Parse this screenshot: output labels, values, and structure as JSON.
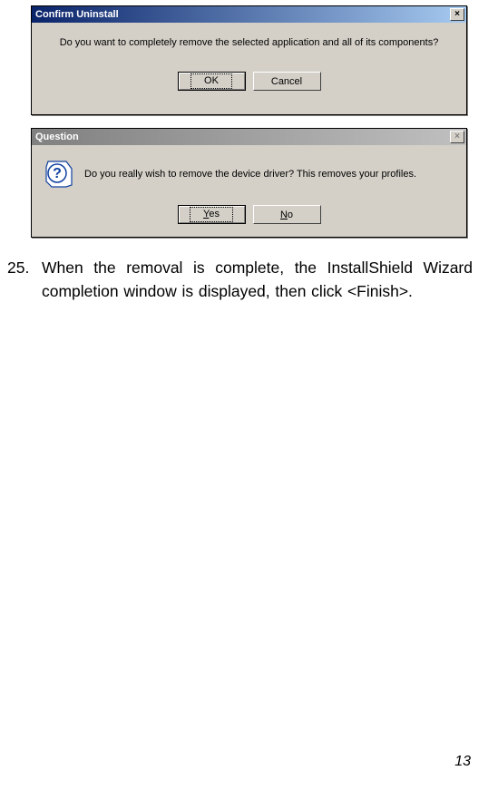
{
  "dialog1": {
    "title": "Confirm Uninstall",
    "message": "Do you want to completely remove the selected application and all of its components?",
    "ok_label": "OK",
    "cancel_label": "Cancel"
  },
  "dialog2": {
    "title": "Question",
    "message": "Do you really wish to remove the device driver?  This removes your profiles.",
    "yes_label": "Yes",
    "no_label": "No"
  },
  "instruction": {
    "number": "25.",
    "text": "When the removal is complete, the InstallShield Wizard completion window is displayed, then click <Finish>."
  },
  "page_number": "13"
}
